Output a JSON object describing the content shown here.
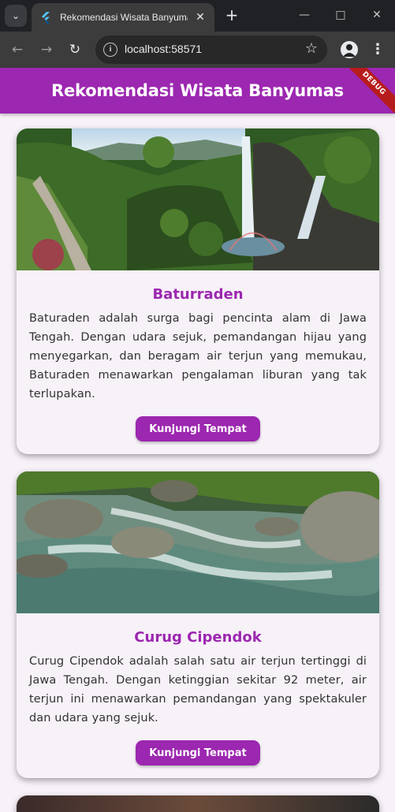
{
  "browser": {
    "tab_title": "Rekomendasi Wisata Banyumas",
    "url": "localhost:58571"
  },
  "app": {
    "title": "Rekomendasi Wisata Banyumas",
    "debug_label": "DEBUG",
    "accent_color": "#9c27b0"
  },
  "destinations": [
    {
      "name": "Baturraden",
      "description": "Baturaden adalah surga bagi pencinta alam di Jawa Tengah. Dengan udara sejuk, pemandangan hijau yang menyegarkan, dan beragam air terjun yang memukau, Baturaden menawarkan pengalaman liburan yang tak terlupakan.",
      "button_label": "Kunjungi Tempat"
    },
    {
      "name": "Curug Cipendok",
      "description": "Curug Cipendok adalah salah satu air terjun tertinggi di Jawa Tengah. Dengan ketinggian sekitar 92 meter, air terjun ini menawarkan pemandangan yang spektakuler dan udara yang sejuk.",
      "button_label": "Kunjungi Tempat"
    }
  ]
}
